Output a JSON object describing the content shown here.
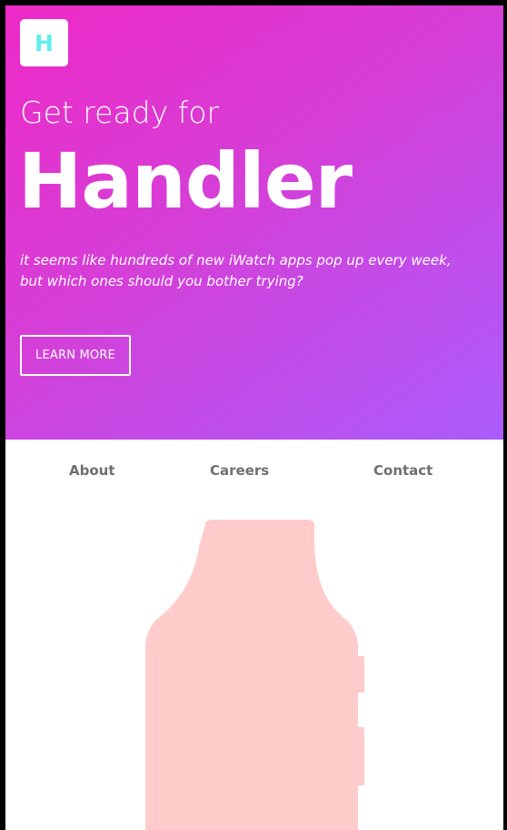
{
  "header": {
    "logo_letter": "H"
  },
  "hero": {
    "kicker": "Get ready for",
    "title": "Handler",
    "tagline": "it seems like hundreds of new iWatch apps pop up every week, but which ones should you bother trying?",
    "cta_label": "LEARN MORE"
  },
  "nav": {
    "items": [
      {
        "label": "About"
      },
      {
        "label": "Careers"
      },
      {
        "label": "Contact"
      }
    ]
  },
  "colors": {
    "gradient_start": "#ee2ac6",
    "gradient_end": "#ab5cfd",
    "logo_letter": "#5ef0ef",
    "nav_text": "#6f6f6f",
    "watch_fill": "#ffcbcb",
    "frame_border": "#000000"
  },
  "illustration": {
    "watch_icon": "smartwatch-silhouette"
  }
}
